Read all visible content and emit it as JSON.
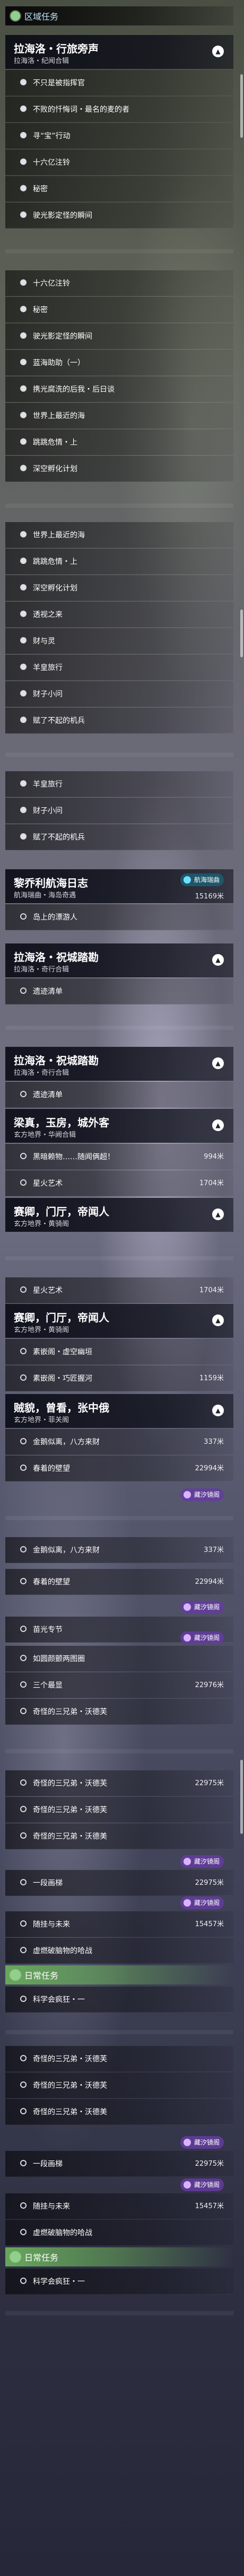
{
  "section_title_1": "区域任务",
  "section_title_2": "日常任务",
  "section_title_3": "日常任务",
  "quests": {
    "q1": {
      "title": "拉海洛・行旅旁声",
      "subtitle": "拉海洛・纪闻合辑",
      "chevron": "▲"
    },
    "q2": {
      "title": "黎乔利航海日志",
      "subtitle": "航海瑞曲・海岛奇遇"
    },
    "q3": {
      "title": "拉海洛・祝城踏勘",
      "subtitle": "拉海洛・奇行合辑",
      "chevron": "▲"
    },
    "q4": {
      "title": "拉海洛・祝城踏勘",
      "subtitle": "拉海洛・奇行合辑",
      "chevron": "▲"
    },
    "q5": {
      "title": "梁真，玉房，城外客",
      "subtitle": "玄方地界・华阙合辑",
      "chevron": "▲"
    },
    "q6": {
      "title": "赛卿，门厅，帝闻人",
      "subtitle": "玄方地界・黄骑阁",
      "chevron": "▲"
    },
    "q7": {
      "title": "赛卿，门厅，帝闻人",
      "subtitle": "玄方地界・黄骑阁",
      "chevron": "▲"
    },
    "q8": {
      "title": "贼貌，曾看，张中俄",
      "subtitle": "玄方地界・菲关阁",
      "chevron": "▲"
    }
  },
  "rows": [
    {
      "label": "不只是被指挥官",
      "rv": ""
    },
    {
      "label": "不败的忏悔词・最名的麦的者",
      "rv": ""
    },
    {
      "label": "寻“宝”行动",
      "rv": ""
    },
    {
      "label": "十六亿注铃",
      "rv": ""
    },
    {
      "label": "秘密",
      "rv": ""
    },
    {
      "label": "驶光影定怪的瞬间",
      "rv": ""
    },
    {
      "label": "十六亿注铃",
      "rv": ""
    },
    {
      "label": "秘密",
      "rv": ""
    },
    {
      "label": "驶光影定怪的瞬间",
      "rv": ""
    },
    {
      "label": "蓝海助助（一）",
      "rv": ""
    },
    {
      "label": "携光腐洗的后我・后日谈",
      "rv": ""
    },
    {
      "label": "世界上最近的海",
      "rv": ""
    },
    {
      "label": "跳跳危情・上",
      "rv": ""
    },
    {
      "label": "深空孵化计划",
      "rv": ""
    },
    {
      "label": "世界上最近的海",
      "rv": ""
    },
    {
      "label": "跳跳危情・上",
      "rv": ""
    },
    {
      "label": "深空孵化计划",
      "rv": ""
    },
    {
      "label": "透视之来",
      "rv": ""
    },
    {
      "label": "财与灵",
      "rv": ""
    },
    {
      "label": "羊皇旅行",
      "rv": ""
    },
    {
      "label": "财子小问",
      "rv": ""
    },
    {
      "label": "赋了不起的机兵",
      "rv": ""
    },
    {
      "label": "羊皇旅行",
      "rv": ""
    },
    {
      "label": "财子小问",
      "rv": ""
    },
    {
      "label": "赋了不起的机兵",
      "rv": ""
    },
    {
      "label": "岛上的漂游人",
      "rv": "15169米"
    },
    {
      "label": "遗迹清单",
      "rv": ""
    },
    {
      "label": "遗迹清单",
      "rv": ""
    },
    {
      "label": "黑暗赖物……随闻俩超！",
      "rv": "994米"
    },
    {
      "label": "星火艺术",
      "rv": "1704米"
    },
    {
      "label": "星火艺术",
      "rv": "1704米"
    },
    {
      "label": "素嵌阁・虚空幽垣",
      "rv": ""
    },
    {
      "label": "素嵌阁・巧匠握河",
      "rv": "1159米"
    },
    {
      "label": "金鹅似离，八方来财",
      "rv": "337米"
    },
    {
      "label": "春着的壁望",
      "rv": "22994米"
    },
    {
      "label": "金鹅似离，八方来财",
      "rv": "337米"
    },
    {
      "label": "春着的壁望",
      "rv": "22994米"
    },
    {
      "label": "苗光专节",
      "rv": ""
    },
    {
      "label": "如圆颜颤两图圈",
      "rv": ""
    },
    {
      "label": "三个最显",
      "rv": "22976米"
    },
    {
      "label": "奇怪的三兄弟・沃德芙",
      "rv": ""
    },
    {
      "label": "奇怪的三兄弟・沃德芙",
      "rv": "22975米"
    },
    {
      "label": "奇怪的三兄弟・沃德芙",
      "rv": ""
    },
    {
      "label": "奇怪的三兄弟・沃德美",
      "rv": ""
    },
    {
      "label": "一段画梯",
      "rv": "22975米"
    },
    {
      "label": "随挂与未来",
      "rv": "15457米"
    },
    {
      "label": "虚燃破脑物的哈战",
      "rv": ""
    },
    {
      "label": "科学会疯狂・一",
      "rv": ""
    },
    {
      "label": "奇怪的三兄弟・沃德芙",
      "rv": ""
    },
    {
      "label": "奇怪的三兄弟・沃德芙",
      "rv": ""
    },
    {
      "label": "奇怪的三兄弟・沃德美",
      "rv": ""
    },
    {
      "label": "一段画梯",
      "rv": "22975米"
    },
    {
      "label": "随挂与未来",
      "rv": "15457米"
    },
    {
      "label": "虚燃破脑物的哈战",
      "rv": ""
    },
    {
      "label": "科学会疯狂・一",
      "rv": ""
    }
  ],
  "badges": {
    "navigate_label": "航海瑞曲",
    "nav_label": "藏汐镜阁"
  }
}
